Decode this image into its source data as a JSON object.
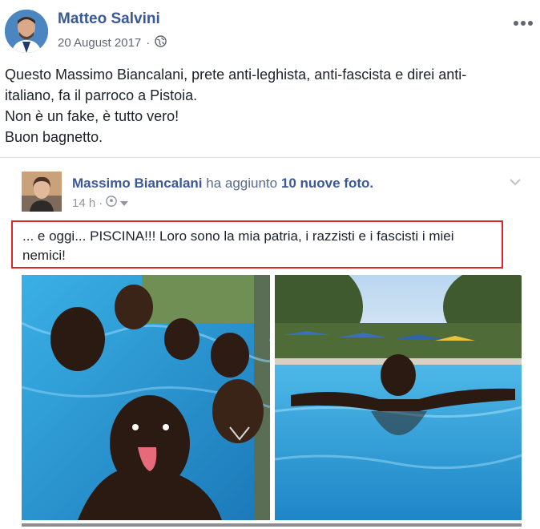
{
  "post": {
    "author": "Matteo Salvini",
    "date": "20 August 2017",
    "dot": "·",
    "privacy_icon": "globe-icon",
    "more_icon": "ellipsis-icon",
    "text_lines": [
      "Questo Massimo Biancalani, prete anti-leghista, anti-fascista e direi anti-",
      "italiano, fa il parroco a Pistoia.",
      "Non è un fake, è tutto vero!",
      "Buon bagnetto."
    ]
  },
  "shared_post": {
    "author": "Massimo Biancalani",
    "action_prefix": "ha aggiunto",
    "count": "10",
    "action_suffix": "nuove foto.",
    "time": "14 h",
    "dot": "·",
    "caption": "... e oggi... PISCINA!!! Loro sono la mia patria, i razzisti e i fascisti i miei nemici!",
    "accent_border_color": "#d9262c"
  },
  "colors": {
    "link": "#385898",
    "meta": "#606770",
    "pool": "#2a9fd6"
  }
}
